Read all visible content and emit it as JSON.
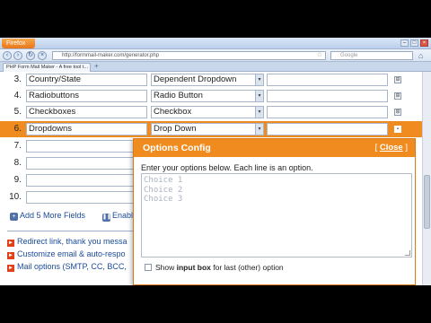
{
  "browser": {
    "app_button": "Firefox",
    "url": "http://formmail-maker.com/generator.php",
    "search_placeholder": "Google",
    "tab_title": "PHP Form Mail Maker - A free tool t..."
  },
  "rows": [
    {
      "num": "3.",
      "name": "Country/State",
      "type": "Dependent Dropdown",
      "extra": "",
      "icon": "⊞",
      "active": false
    },
    {
      "num": "4.",
      "name": "Radiobuttons",
      "type": "Radio Button",
      "extra": "",
      "icon": "⊞",
      "active": false
    },
    {
      "num": "5.",
      "name": "Checkboxes",
      "type": "Checkbox",
      "extra": "",
      "icon": "⊞",
      "active": false
    },
    {
      "num": "6.",
      "name": "Dropdowns",
      "type": "Drop Down",
      "extra": "",
      "icon": "▪",
      "active": true
    },
    {
      "num": "7.",
      "name": "",
      "type": "",
      "extra": "",
      "icon": "",
      "active": false
    },
    {
      "num": "8.",
      "name": "",
      "type": "",
      "extra": "",
      "icon": "",
      "active": false
    },
    {
      "num": "9.",
      "name": "",
      "type": "",
      "extra": "",
      "icon": "",
      "active": false
    },
    {
      "num": "10.",
      "name": "",
      "type": "",
      "extra": "",
      "icon": "",
      "active": false
    }
  ],
  "links": {
    "add_more": "Add 5 More Fields",
    "enable": "Enabl",
    "options": [
      "Redirect link, thank you messa",
      "Customize email & auto-respo",
      "Mail options (SMTP, CC, BCC,"
    ]
  },
  "popup": {
    "title": "Options Config",
    "close_bracket_open": "[ ",
    "close_label": "Close",
    "close_bracket_close": " ]",
    "instructions": "Enter your options below. Each line is an option.",
    "choices_text": "Choice 1\nChoice 2\nChoice 3",
    "checkbox_prefix": "Show ",
    "checkbox_bold": "input box",
    "checkbox_suffix": " for last (other) option"
  },
  "colors": {
    "accent": "#f08c1f",
    "link": "#1a4b9b"
  }
}
